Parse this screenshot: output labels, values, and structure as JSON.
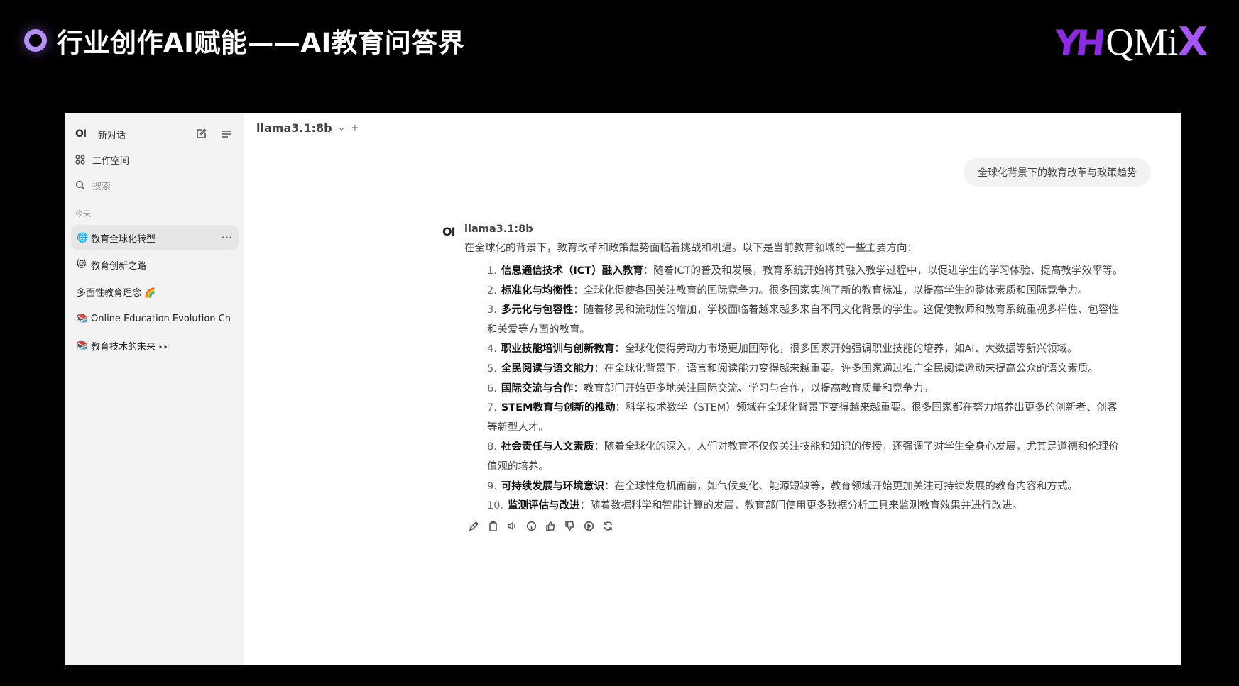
{
  "slide": {
    "title": "行业创作AI赋能——AI教育问答界",
    "logo_mark": "YH",
    "logo_text": "QMi",
    "logo_x": "X"
  },
  "sidebar": {
    "logo": "OI",
    "new_chat": "新对话",
    "workspace": "工作空间",
    "search_placeholder": "搜索",
    "section_today": "今天",
    "chats": [
      {
        "emoji": "🌐",
        "title": "教育全球化转型",
        "more": "···"
      },
      {
        "emoji": "🐱",
        "title": "教育创新之路"
      },
      {
        "emoji": "",
        "title": "多面性教育理念 🌈"
      },
      {
        "emoji": "📚",
        "title": "Online Education Evolution Ch"
      },
      {
        "emoji": "📚",
        "title": "教育技术的未来 👀"
      }
    ]
  },
  "header": {
    "model": "llama3.1:8b",
    "chevron": "⌄",
    "plus": "+"
  },
  "conversation": {
    "user_message": "全球化背景下的教育改革与政策趋势",
    "assistant": {
      "avatar": "OI",
      "name": "llama3.1:8b",
      "intro": "在全球化的背景下，教育改革和政策趋势面临着挑战和机遇。以下是当前教育领域的一些主要方向：",
      "items": [
        {
          "num": "1.",
          "title": "信息通信技术（ICT）融入教育",
          "text": "：随着ICT的普及和发展，教育系统开始将其融入教学过程中，以促进学生的学习体验、提高教学效率等。"
        },
        {
          "num": "2.",
          "title": "标准化与均衡性",
          "text": "：全球化促使各国关注教育的国际竞争力。很多国家实施了新的教育标准，以提高学生的整体素质和国际竞争力。"
        },
        {
          "num": "3.",
          "title": "多元化与包容性",
          "text": "：随着移民和流动性的增加，学校面临着越来越多来自不同文化背景的学生。这促使教师和教育系统重视多样性、包容性和关爱等方面的教育。"
        },
        {
          "num": "4.",
          "title": "职业技能培训与创新教育",
          "text": "：全球化使得劳动力市场更加国际化，很多国家开始强调职业技能的培养，如AI、大数据等新兴领域。"
        },
        {
          "num": "5.",
          "title": "全民阅读与语文能力",
          "text": "：在全球化背景下，语言和阅读能力变得越来越重要。许多国家通过推广全民阅读运动来提高公众的语文素质。"
        },
        {
          "num": "6.",
          "title": "国际交流与合作",
          "text": "：教育部门开始更多地关注国际交流、学习与合作，以提高教育质量和竞争力。"
        },
        {
          "num": "7.",
          "title": "STEM教育与创新的推动",
          "text": "：科学技术数学（STEM）领域在全球化背景下变得越来越重要。很多国家都在努力培养出更多的创新者、创客等新型人才。"
        },
        {
          "num": "8.",
          "title": "社会责任与人文素质",
          "text": "：随着全球化的深入，人们对教育不仅仅关注技能和知识的传授，还强调了对学生全身心发展，尤其是道德和伦理价值观的培养。"
        },
        {
          "num": "9.",
          "title": "可持续发展与环境意识",
          "text": "：在全球性危机面前，如气候变化、能源短缺等，教育领域开始更加关注可持续发展的教育内容和方式。"
        },
        {
          "num": "10.",
          "title": "监测评估与改进",
          "text": "：随着数据科学和智能计算的发展，教育部门使用更多数据分析工具来监测教育效果并进行改进。"
        }
      ]
    }
  }
}
